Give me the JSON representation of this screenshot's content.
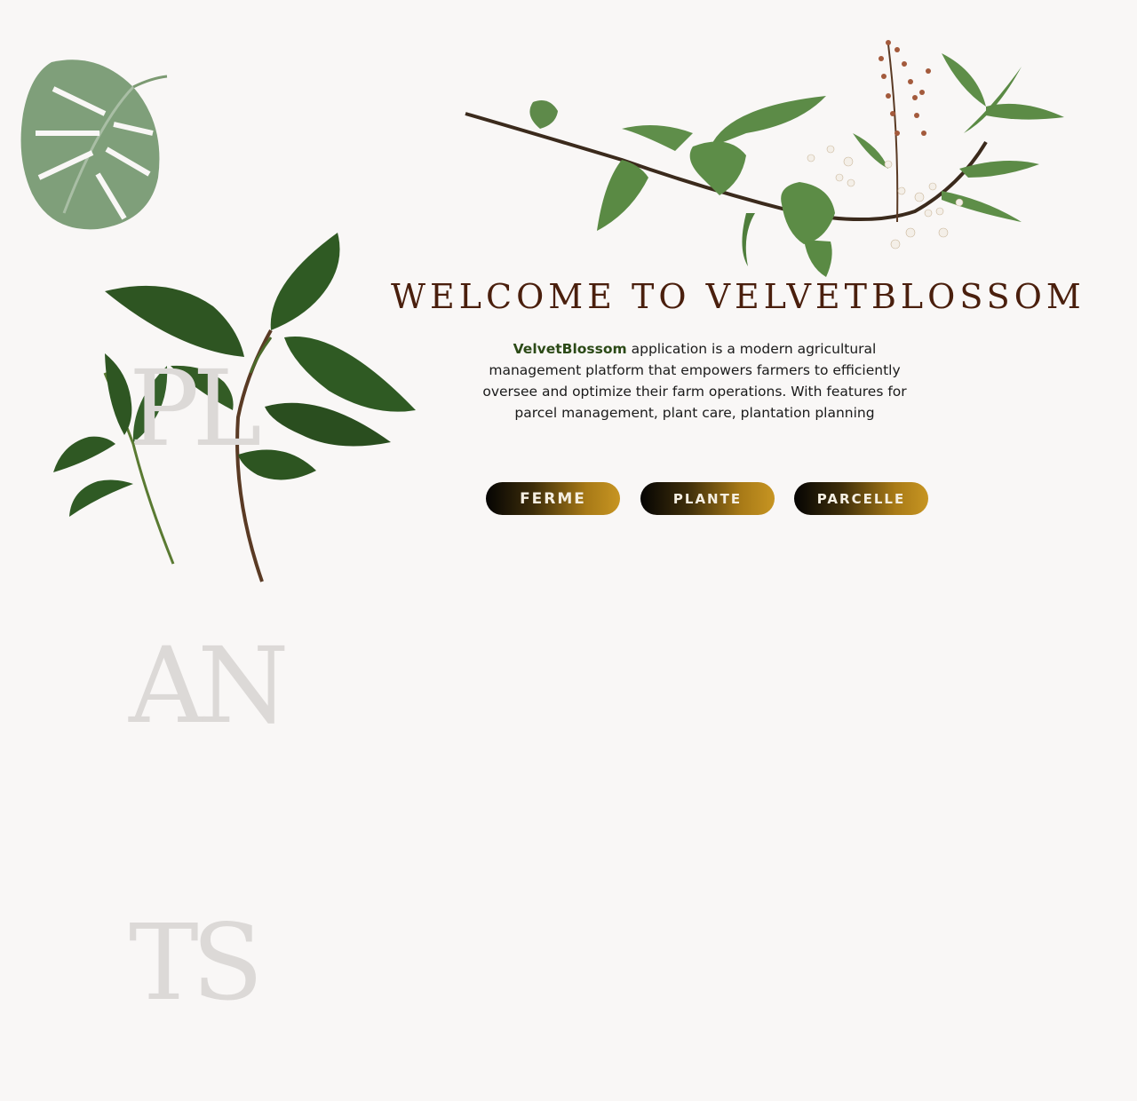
{
  "decor": {
    "letters": [
      "PL",
      "AN",
      "TS"
    ]
  },
  "hero": {
    "title": "WELCOME TO VELVETBLOSSOM",
    "brand": "VelvetBlossom",
    "description": " application is a modern agricultural management platform that empowers farmers to efficiently oversee and optimize their farm operations. With features for parcel management, plant care, plantation planning"
  },
  "buttons": {
    "ferme": "FERME",
    "plante": "PLANTE",
    "parcelle": "PARCELLE"
  },
  "colors": {
    "background": "#f9f7f6",
    "title": "#4a1f0d",
    "brand": "#2c4a17",
    "button_start": "#050403",
    "button_end": "#c79522"
  }
}
